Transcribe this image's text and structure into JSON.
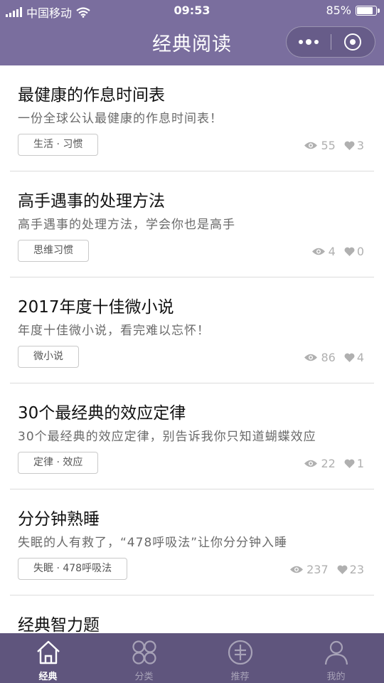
{
  "status_bar": {
    "carrier": "中国移动",
    "time": "09:53",
    "battery": "85%",
    "battery_level": 0.85
  },
  "nav": {
    "title": "经典阅读",
    "more_icon": "more-dots-icon",
    "close_icon": "target-close-icon"
  },
  "articles": [
    {
      "title": "最健康的作息时间表",
      "summary": "一份全球公认最健康的作息时间表！",
      "tag": "生活 · 习惯",
      "views": "55",
      "likes": "3"
    },
    {
      "title": "高手遇事的处理方法",
      "summary": "高手遇事的处理方法，学会你也是高手",
      "tag": "思维习惯",
      "views": "4",
      "likes": "0"
    },
    {
      "title": "2017年度十佳微小说",
      "summary": "年度十佳微小说，看完难以忘怀！",
      "tag": "微小说",
      "views": "86",
      "likes": "4"
    },
    {
      "title": "30个最经典的效应定律",
      "summary": "30个最经典的效应定律，别告诉我你只知道蝴蝶效应",
      "tag": "定律 · 效应",
      "views": "22",
      "likes": "1"
    },
    {
      "title": "分分钟熟睡",
      "summary": "失眠的人有救了，“478呼吸法”让你分分钟入睡",
      "tag": "失眠 · 478呼吸法",
      "views": "237",
      "likes": "23"
    },
    {
      "title": "经典智力题"
    }
  ],
  "tabs": [
    {
      "label": "经典",
      "icon": "home-icon",
      "active": true
    },
    {
      "label": "分类",
      "icon": "grid-icon",
      "active": false
    },
    {
      "label": "推荐",
      "icon": "recommend-icon",
      "active": false
    },
    {
      "label": "我的",
      "icon": "user-icon",
      "active": false
    }
  ],
  "colors": {
    "header": "#7a6e9e",
    "tabbar": "#5f557d",
    "stats": "#b0b0b0"
  }
}
